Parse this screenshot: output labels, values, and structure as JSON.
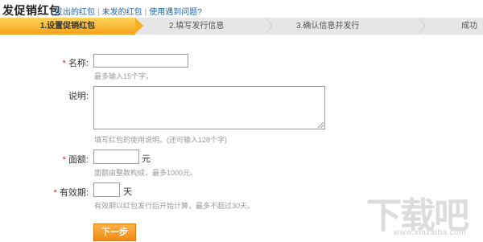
{
  "header": {
    "title": "发促销红包",
    "links": [
      "发出的红包",
      "未发的红包",
      "使用遇到问题?"
    ],
    "separator": "|"
  },
  "steps": [
    {
      "label": "1.设置促销红包",
      "active": true
    },
    {
      "label": "2.填写发行信息",
      "active": false
    },
    {
      "label": "3.确认信息并发行",
      "active": false
    },
    {
      "label": "成功",
      "active": false
    }
  ],
  "form": {
    "name": {
      "label": "名称:",
      "required": true,
      "value": "",
      "hint": "最多输入15个字。"
    },
    "description": {
      "label": "说明:",
      "required": false,
      "value": "",
      "hint": "填写红包的使用说明。(还可输入128个字)"
    },
    "amount": {
      "label": "面额:",
      "required": true,
      "value": "",
      "unit": "元",
      "hint": "面额由整数构成，最多1000元。"
    },
    "validity": {
      "label": "有效期:",
      "required": true,
      "value": "",
      "unit": "天",
      "hint": "有效期以红包发行后开始计算，最多不超过30天。"
    },
    "required_mark": "*"
  },
  "actions": {
    "next_label": "下一步"
  },
  "watermark": {
    "main": "下载吧",
    "url": "www.xiazaiba.com"
  },
  "colors": {
    "accent": "#f4a11a",
    "link": "#1a66b3",
    "required": "#e02020",
    "hint": "#999999"
  }
}
